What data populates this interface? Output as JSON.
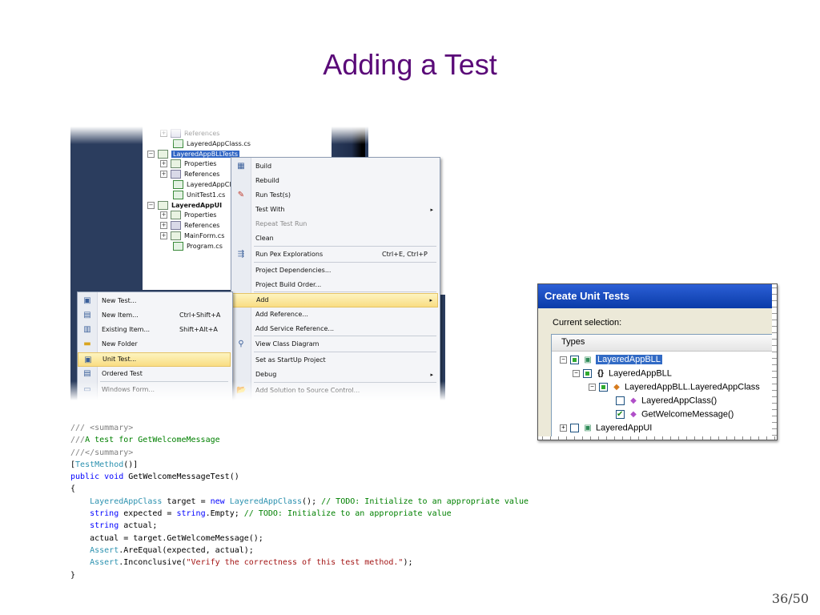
{
  "slide": {
    "title": "Adding a Test",
    "page_number": "36/50"
  },
  "solution_tree": {
    "rows": [
      {
        "label": "References",
        "expander": "+",
        "icon": "references-icon"
      },
      {
        "label": "LayeredAppClass.cs",
        "icon": "csharp-file-icon"
      },
      {
        "label": "LayeredAppBLLTests",
        "expander": "−",
        "icon": "project-icon",
        "selected": true
      },
      {
        "label": "Properties",
        "expander": "+",
        "icon": "properties-icon"
      },
      {
        "label": "References",
        "expander": "+",
        "icon": "references-icon"
      },
      {
        "label": "LayeredAppCl",
        "icon": "csharp-file-icon"
      },
      {
        "label": "UnitTest1.cs",
        "icon": "csharp-file-icon"
      },
      {
        "label": "LayeredAppUI",
        "expander": "−",
        "icon": "project-icon",
        "bold": true
      },
      {
        "label": "Properties",
        "expander": "+",
        "icon": "properties-icon"
      },
      {
        "label": "References",
        "expander": "+",
        "icon": "references-icon"
      },
      {
        "label": "MainForm.cs",
        "expander": "+",
        "icon": "form-icon"
      },
      {
        "label": "Program.cs",
        "icon": "csharp-file-icon"
      }
    ]
  },
  "context_menu": {
    "items": [
      {
        "label": "Build",
        "icon": "build-icon"
      },
      {
        "label": "Rebuild"
      },
      {
        "label": "Run Test(s)",
        "icon": "run-test-icon"
      },
      {
        "label": "Test With",
        "submenu": "▸"
      },
      {
        "label": "Repeat Test Run",
        "disabled": true
      },
      {
        "label": "Clean"
      },
      {
        "label": "Run Pex Explorations",
        "shortcut": "Ctrl+E, Ctrl+P",
        "icon": "pex-icon"
      },
      {
        "label": "Project Dependencies..."
      },
      {
        "label": "Project Build Order..."
      },
      {
        "label": "Add",
        "submenu": "▸",
        "highlighted": true
      },
      {
        "label": "Add Reference..."
      },
      {
        "label": "Add Service Reference..."
      },
      {
        "label": "View Class Diagram",
        "icon": "class-diagram-icon"
      },
      {
        "label": "Set as StartUp Project"
      },
      {
        "label": "Debug",
        "submenu": "▸"
      },
      {
        "label": "Add Solution to Source Control...",
        "icon": "source-control-icon"
      }
    ]
  },
  "add_submenu": {
    "items": [
      {
        "label": "New Test...",
        "icon": "new-test-icon"
      },
      {
        "label": "New Item...",
        "shortcut": "Ctrl+Shift+A",
        "icon": "new-item-icon"
      },
      {
        "label": "Existing Item...",
        "shortcut": "Shift+Alt+A",
        "icon": "existing-item-icon"
      },
      {
        "label": "New Folder",
        "icon": "folder-icon"
      },
      {
        "label": "Unit Test...",
        "icon": "unit-test-icon",
        "highlighted": true
      },
      {
        "label": "Ordered Test",
        "icon": "ordered-test-icon"
      },
      {
        "label": "Windows Form...",
        "icon": "windows-form-icon"
      }
    ]
  },
  "create_unit_tests": {
    "title": "Create Unit Tests",
    "current_selection_label": "Current selection:",
    "types_header": "Types",
    "rows": [
      {
        "label": "LayeredAppBLL",
        "expander": "−",
        "check": "part",
        "icon": "project-icon",
        "selected": true
      },
      {
        "label": "LayeredAppBLL",
        "expander": "−",
        "check": "part",
        "icon": "namespace-icon",
        "glyph": "{ }"
      },
      {
        "label": "LayeredAppBLL.LayeredAppClass",
        "expander": "−",
        "check": "part",
        "icon": "class-icon"
      },
      {
        "label": "LayeredAppClass()",
        "check": "none",
        "icon": "method-icon"
      },
      {
        "label": "GetWelcomeMessage()",
        "check": "chk",
        "icon": "method-icon"
      },
      {
        "label": "LayeredAppUI",
        "expander": "+",
        "check": "none",
        "icon": "project-icon"
      }
    ]
  },
  "code": {
    "lines": [
      [
        {
          "t": "/// <summary>",
          "c": "c-gray"
        }
      ],
      [
        {
          "t": "///",
          "c": "c-gray"
        },
        {
          "t": "A test for GetWelcomeMessage",
          "c": "c-cmt"
        }
      ],
      [
        {
          "t": "///</summary>",
          "c": "c-gray"
        }
      ],
      [
        {
          "t": "[",
          "c": ""
        },
        {
          "t": "TestMethod",
          "c": "c-type"
        },
        {
          "t": "()]",
          "c": ""
        }
      ],
      [
        {
          "t": "public",
          "c": "c-kw"
        },
        {
          "t": " ",
          "c": ""
        },
        {
          "t": "void",
          "c": "c-kw"
        },
        {
          "t": " GetWelcomeMessageTest()",
          "c": ""
        }
      ],
      [
        {
          "t": "{",
          "c": ""
        }
      ],
      [
        {
          "t": "    ",
          "c": ""
        },
        {
          "t": "LayeredAppClass",
          "c": "c-type"
        },
        {
          "t": " target = ",
          "c": ""
        },
        {
          "t": "new",
          "c": "c-kw"
        },
        {
          "t": " ",
          "c": ""
        },
        {
          "t": "LayeredAppClass",
          "c": "c-type"
        },
        {
          "t": "(); ",
          "c": ""
        },
        {
          "t": "// TODO: Initialize to an appropriate value",
          "c": "c-cmt"
        }
      ],
      [
        {
          "t": "    ",
          "c": ""
        },
        {
          "t": "string",
          "c": "c-kw"
        },
        {
          "t": " expected = ",
          "c": ""
        },
        {
          "t": "string",
          "c": "c-kw"
        },
        {
          "t": ".Empty; ",
          "c": ""
        },
        {
          "t": "// TODO: Initialize to an appropriate value",
          "c": "c-cmt"
        }
      ],
      [
        {
          "t": "    ",
          "c": ""
        },
        {
          "t": "string",
          "c": "c-kw"
        },
        {
          "t": " actual;",
          "c": ""
        }
      ],
      [
        {
          "t": "    actual = target.GetWelcomeMessage();",
          "c": ""
        }
      ],
      [
        {
          "t": "    ",
          "c": ""
        },
        {
          "t": "Assert",
          "c": "c-type"
        },
        {
          "t": ".AreEqual(expected, actual);",
          "c": ""
        }
      ],
      [
        {
          "t": "    ",
          "c": ""
        },
        {
          "t": "Assert",
          "c": "c-type"
        },
        {
          "t": ".Inconclusive(",
          "c": ""
        },
        {
          "t": "\"Verify the correctness of this test method.\"",
          "c": "c-str"
        },
        {
          "t": ");",
          "c": ""
        }
      ],
      [
        {
          "t": "}",
          "c": ""
        }
      ]
    ]
  }
}
